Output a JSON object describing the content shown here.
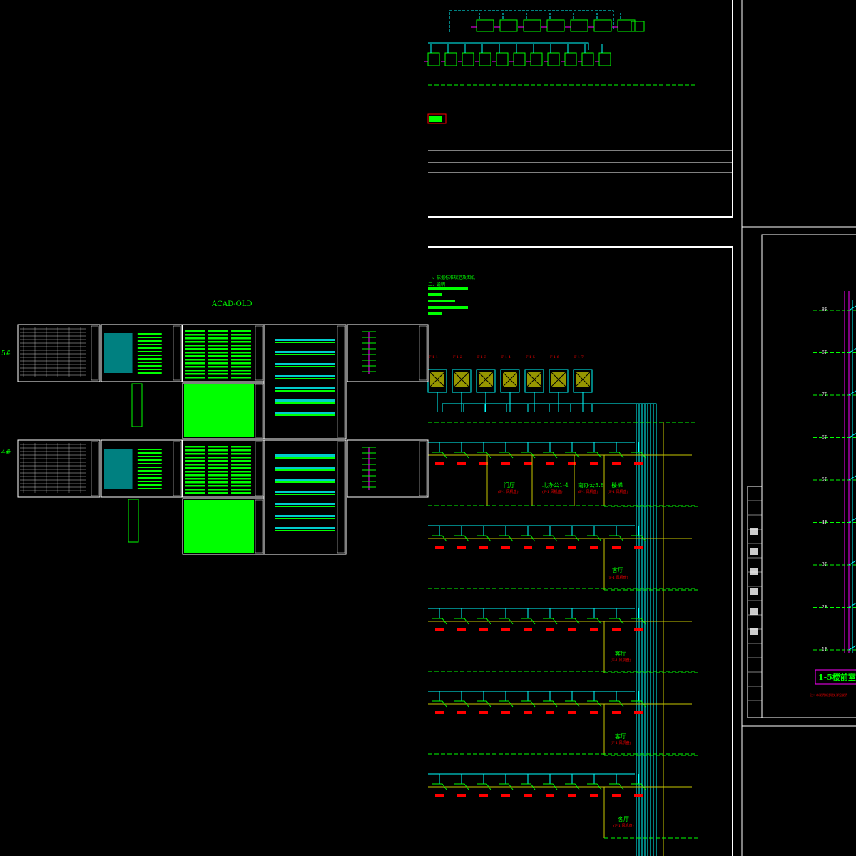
{
  "app": {
    "background": "#000000"
  },
  "colors": {
    "frame": "#ffffff",
    "green": "#00ff00",
    "cyan": "#00ffff",
    "red": "#ff0000",
    "magenta": "#ff00ff",
    "yellow": "#c8c800"
  },
  "overview": {
    "title": "ACAD-OLD",
    "row_labels": [
      "5#",
      "4#"
    ]
  },
  "system_units": {
    "tags": [
      "F-1-1",
      "F-1-2",
      "F-1-3",
      "F-1-4",
      "F-1-5",
      "F-1-6",
      "F-1-7"
    ]
  },
  "rooms": {
    "floor1": [
      "门厅",
      "北办公1-4",
      "南办公5.8",
      "楼梯"
    ],
    "upper": [
      "客厅",
      "客厅",
      "客厅"
    ],
    "sublabel": "(F-1 风机盘)"
  },
  "riser": {
    "floors": [
      "8F",
      "6F",
      "7F",
      "6F",
      "5F",
      "4F",
      "3F",
      "2F",
      "1F"
    ],
    "title": "1-5楼前室正",
    "note": "注：本说明未注明处详见说明"
  },
  "annotations": {
    "notes": [
      "一、依据标准规范及图纸",
      "二、说明"
    ]
  }
}
